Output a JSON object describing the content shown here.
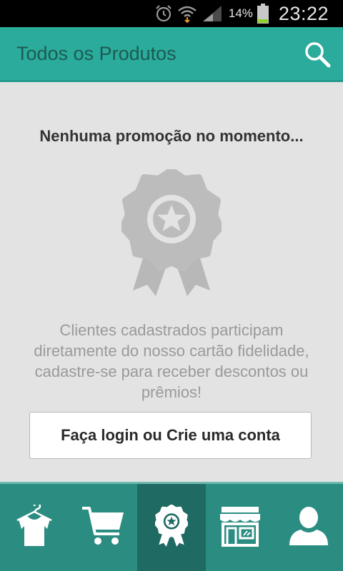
{
  "statusbar": {
    "battery_percent": "14%",
    "time": "23:22"
  },
  "appbar": {
    "title": "Todos os Produtos",
    "search_icon": "search-icon"
  },
  "empty_state": {
    "heading": "Nenhuma promoção no momento...",
    "illustration_icon": "award-badge-icon",
    "description": "Clientes cadastrados participam diretamente do nosso cartão fidelidade, cadastre-se para receber descontos ou prêmios!",
    "button_label": "Faça login ou Crie uma conta"
  },
  "bottom_nav": {
    "items": [
      {
        "icon": "clothing-icon",
        "active": false
      },
      {
        "icon": "cart-icon",
        "active": false
      },
      {
        "icon": "award-icon",
        "active": true
      },
      {
        "icon": "store-icon",
        "active": false
      },
      {
        "icon": "user-icon",
        "active": false
      }
    ]
  },
  "colors": {
    "primary": "#2bab9b",
    "nav_background": "#2b8d82",
    "nav_active": "#1f6a62",
    "page_background": "#e3e3e3"
  }
}
